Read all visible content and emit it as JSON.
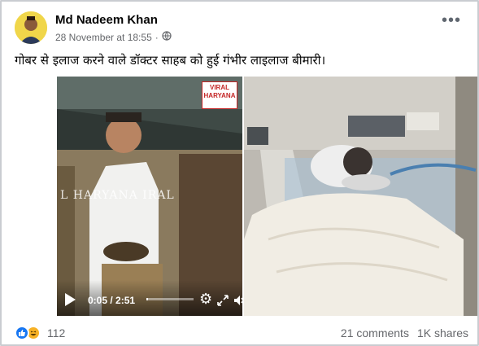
{
  "post": {
    "author": "Md Nadeem Khan",
    "timestamp": "28 November at 18:55",
    "separator": "·",
    "caption": "गोबर से इलाज करने वाले डॉक्टर साहब को हुई गंभीर लाइलाज बीमारी।"
  },
  "video": {
    "time": "0:05 / 2:51",
    "progress": 0.03,
    "badge_line1": "VIRAL",
    "badge_line2": "HARYANA",
    "watermark": "L HARYANA  IRAL"
  },
  "footer": {
    "reaction_count": "112",
    "comments": "21 comments",
    "shares": "1K shares"
  },
  "colors": {
    "accent": "#1877f2",
    "haha": "#f7b125",
    "badge_red": "#c42525"
  }
}
